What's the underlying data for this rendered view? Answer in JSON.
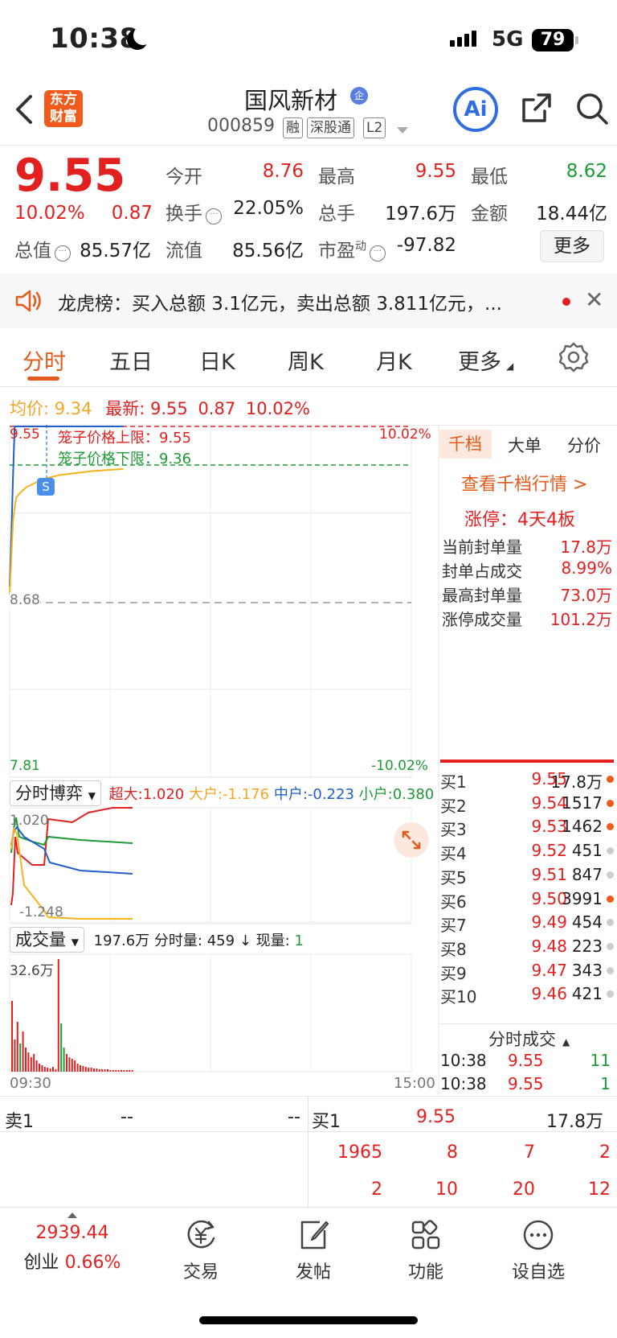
{
  "status": {
    "time": "10:38",
    "network": "5G",
    "battery": "79"
  },
  "header": {
    "logo_line1": "东方",
    "logo_line2": "财富",
    "name": "国风新材",
    "name_badge": "企",
    "code": "000859",
    "tags": [
      "融",
      "深股通",
      "L2"
    ],
    "ai_label": "Ai"
  },
  "quote": {
    "price": "9.55",
    "change_pct": "10.02%",
    "change": "0.87",
    "labels": {
      "open": "今开",
      "high": "最高",
      "low": "最低",
      "turnover": "换手",
      "volume": "总手",
      "amount": "金额",
      "mktcap": "总值",
      "float": "流值",
      "pe": "市盈",
      "pe_sup": "动"
    },
    "open": "8.76",
    "high": "9.55",
    "low": "8.62",
    "turnover": "22.05%",
    "volume": "197.6万",
    "amount": "18.44亿",
    "mktcap": "85.57亿",
    "float": "85.56亿",
    "pe": "-97.82",
    "more": "更多"
  },
  "news": {
    "text": "龙虎榜：买入总额 3.1亿元，卖出总额 3.811亿元，..."
  },
  "tabs": [
    "分时",
    "五日",
    "日K",
    "周K",
    "月K",
    "更多"
  ],
  "chart_info": {
    "avg_label": "均价:",
    "avg": "9.34",
    "last_label": "最新:",
    "last": "9.55",
    "chg": "0.87",
    "pct": "10.02%"
  },
  "chart_data": {
    "type": "line",
    "title": "",
    "y_labels": {
      "top": "9.55",
      "mid": "8.68",
      "bottom": "7.81",
      "top_pct": "10.02%",
      "bottom_pct": "-10.02%"
    },
    "cage_upper": "笼子价格上限：9.55",
    "cage_lower": "笼子价格下限：9.36",
    "x_labels": [
      "09:30",
      "15:00"
    ],
    "ylim": [
      7.81,
      9.55
    ],
    "series": [
      {
        "name": "价格",
        "color": "#2060c8",
        "x": [
          "09:30",
          "09:31",
          "09:32",
          "09:33",
          "09:34",
          "09:35",
          "09:36",
          "09:40",
          "09:45",
          "09:50",
          "10:00",
          "10:10",
          "10:20",
          "10:38"
        ],
        "values": [
          8.76,
          9.0,
          9.3,
          9.55,
          9.55,
          9.55,
          9.55,
          9.55,
          9.55,
          9.55,
          9.55,
          9.55,
          9.55,
          9.55
        ]
      },
      {
        "name": "均价",
        "color": "#f5b31e",
        "x": [
          "09:30",
          "09:31",
          "09:32",
          "09:33",
          "09:34",
          "09:35",
          "09:36",
          "09:40",
          "09:45",
          "09:50",
          "10:00",
          "10:10",
          "10:20",
          "10:38"
        ],
        "values": [
          8.72,
          8.9,
          9.08,
          9.15,
          9.2,
          9.21,
          9.22,
          9.25,
          9.27,
          9.29,
          9.31,
          9.32,
          9.33,
          9.34
        ]
      }
    ],
    "marker_s": "S"
  },
  "right_panel": {
    "tabs": [
      "千档",
      "大单",
      "分价"
    ],
    "link": "查看千档行情 >",
    "limit_up": "涨停：4天4板",
    "rows": [
      {
        "label": "当前封单量",
        "value": "17.8万"
      },
      {
        "label": "封单占成交",
        "value": "8.99%"
      },
      {
        "label": "最高封单量",
        "value": "73.0万"
      },
      {
        "label": "涨停成交量",
        "value": "101.2万"
      }
    ],
    "bids": [
      {
        "name": "买1",
        "price": "9.55",
        "qty": "17.8万",
        "dot": "#f05a1a"
      },
      {
        "name": "买2",
        "price": "9.54",
        "qty": "1517",
        "dot": "#f05a1a"
      },
      {
        "name": "买3",
        "price": "9.53",
        "qty": "1462",
        "dot": "#f05a1a"
      },
      {
        "name": "买4",
        "price": "9.52",
        "qty": "451",
        "dot": "#cccccc"
      },
      {
        "name": "买5",
        "price": "9.51",
        "qty": "847",
        "dot": "#cccccc"
      },
      {
        "name": "买6",
        "price": "9.50",
        "qty": "3991",
        "dot": "#f05a1a"
      },
      {
        "name": "买7",
        "price": "9.49",
        "qty": "454",
        "dot": "#cccccc"
      },
      {
        "name": "买8",
        "price": "9.48",
        "qty": "223",
        "dot": "#cccccc"
      },
      {
        "name": "买9",
        "price": "9.47",
        "qty": "343",
        "dot": "#cccccc"
      },
      {
        "name": "买10",
        "price": "9.46",
        "qty": "421",
        "dot": "#cccccc"
      }
    ],
    "ticks_title": "分时成交",
    "ticks": [
      {
        "time": "10:38",
        "price": "9.55",
        "vol": "11"
      },
      {
        "time": "10:38",
        "price": "9.55",
        "vol": "1"
      }
    ]
  },
  "indicator": {
    "select": "分时博弈",
    "super": "超大:1.020",
    "big": "大户:-1.176",
    "mid": "中户:-0.223",
    "small": "小户:0.380",
    "y_top": "1.020",
    "y_bottom": "-1.248"
  },
  "volume": {
    "select": "成交量",
    "total": "197.6万",
    "period_label": "分时量:",
    "period": "459",
    "arrow": "↓",
    "now_label": "现量:",
    "now": "1",
    "y_top": "32.6万"
  },
  "orderbook": {
    "sell1_label": "卖1",
    "sell1_price": "--",
    "sell1_qty": "--",
    "buy1_label": "买1",
    "buy1_price": "9.55",
    "buy1_qty": "17.8万",
    "row1": [
      "1965",
      "8",
      "7",
      "2"
    ],
    "row2": [
      "2",
      "10",
      "20",
      "12"
    ]
  },
  "bottom_nav": {
    "index_value": "2939.44",
    "index_name": "创业",
    "index_pct": "0.66%",
    "items": [
      "交易",
      "发帖",
      "功能",
      "设自选"
    ]
  }
}
